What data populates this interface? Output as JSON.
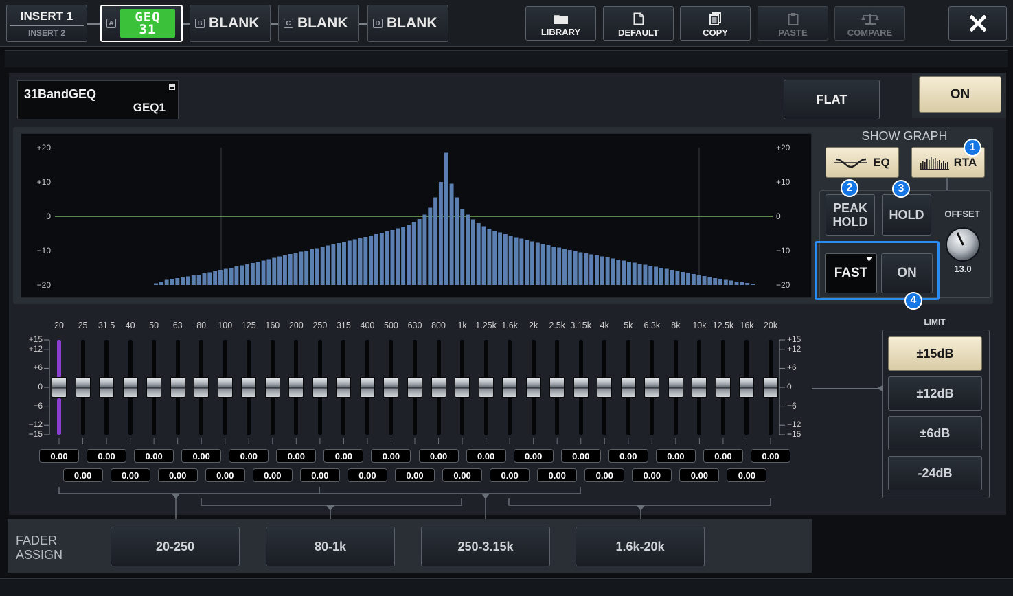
{
  "topbar": {
    "insert_label": "INSERT 1",
    "insert_sub": "INSERT 2",
    "slots": [
      {
        "letter": "A",
        "label": "GEQ31",
        "line1": "GEQ",
        "line2": "31",
        "active": true
      },
      {
        "letter": "B",
        "label": "BLANK",
        "active": false
      },
      {
        "letter": "C",
        "label": "BLANK",
        "active": false
      },
      {
        "letter": "D",
        "label": "BLANK",
        "active": false
      }
    ],
    "buttons": [
      {
        "label": "LIBRARY",
        "icon": "folder-icon",
        "enabled": true
      },
      {
        "label": "DEFAULT",
        "icon": "document-icon",
        "enabled": true
      },
      {
        "label": "COPY",
        "icon": "copy-icon",
        "enabled": true
      },
      {
        "label": "PASTE",
        "icon": "clipboard-icon",
        "enabled": false
      },
      {
        "label": "COMPARE",
        "icon": "balance-icon",
        "enabled": false
      }
    ],
    "close_icon": "close-icon"
  },
  "header": {
    "effect_type": "31BandGEQ",
    "effect_name": "GEQ1",
    "flat_label": "FLAT",
    "on_label": "ON"
  },
  "graph": {
    "y_ticks": [
      "+20",
      "+10",
      "0",
      "−10",
      "−20"
    ],
    "accent_color": "#5a7fb0",
    "zero_line_color": "#8ccf6a"
  },
  "chart_data": {
    "type": "bar",
    "ylim": [
      -20,
      20
    ],
    "x_index": [
      0,
      1,
      2,
      3,
      4,
      5,
      6,
      7,
      8,
      9,
      10,
      11,
      12,
      13,
      14,
      15,
      16,
      17,
      18,
      19,
      20,
      21,
      22,
      23,
      24,
      25,
      26,
      27,
      28,
      29,
      30,
      31,
      32,
      33,
      34,
      35,
      36,
      37,
      38,
      39,
      40,
      41,
      42,
      43,
      44,
      45,
      46,
      47,
      48,
      49,
      50,
      51,
      52,
      53,
      54,
      55,
      56,
      57,
      58,
      59,
      60,
      61,
      62,
      63,
      64,
      65,
      66,
      67,
      68,
      69,
      70,
      71,
      72,
      73,
      74,
      75,
      76,
      77,
      78,
      79,
      80,
      81,
      82,
      83,
      84,
      85,
      86,
      87,
      88,
      89,
      90,
      91,
      92,
      93,
      94,
      95,
      96,
      97,
      98,
      99,
      100,
      101,
      102,
      103,
      104,
      105,
      106,
      107,
      108,
      109,
      110,
      111,
      112,
      113,
      114,
      115,
      116,
      117,
      118,
      119,
      120
    ],
    "values": [
      -19.5,
      -19,
      -18.5,
      -18.2,
      -18,
      -17.8,
      -17.5,
      -17.2,
      -17,
      -16.6,
      -16.3,
      -16,
      -15.6,
      -15.3,
      -15,
      -14.6,
      -14.3,
      -14,
      -13.6,
      -13.2,
      -12.9,
      -12.5,
      -12.1,
      -11.7,
      -11.4,
      -11,
      -10.7,
      -10.3,
      -10,
      -9.6,
      -9.3,
      -8.9,
      -8.5,
      -8.2,
      -7.8,
      -7.5,
      -7.1,
      -6.7,
      -6.4,
      -6,
      -5.6,
      -5.2,
      -4.8,
      -4.4,
      -4,
      -3.5,
      -3,
      -2.4,
      -1.7,
      -0.8,
      0.5,
      2.5,
      5.5,
      10,
      18.5,
      9.5,
      5.5,
      2.2,
      0.5,
      -0.9,
      -2,
      -2.9,
      -3.6,
      -4.2,
      -4.7,
      -5.2,
      -5.7,
      -6.1,
      -6.5,
      -6.9,
      -7.3,
      -7.7,
      -8.1,
      -8.4,
      -8.8,
      -9.1,
      -9.5,
      -9.8,
      -10.1,
      -10.5,
      -10.8,
      -11.1,
      -11.4,
      -11.7,
      -12,
      -12.3,
      -12.6,
      -12.9,
      -13.2,
      -13.5,
      -13.8,
      -14.1,
      -14.4,
      -14.7,
      -15,
      -15.3,
      -15.6,
      -15.9,
      -16.2,
      -16.5,
      -16.8,
      -17.1,
      -17.4,
      -17.7,
      -18,
      -18.2,
      -18.5,
      -18.7,
      -19,
      -19.2,
      -19.4,
      -19.6
    ],
    "title": "",
    "xlabel": "",
    "ylabel": ""
  },
  "show_graph": {
    "title": "SHOW GRAPH",
    "eq_label": "EQ",
    "rta_label": "RTA",
    "eq_icon": "eq-curve-icon",
    "rta_icon": "rta-bars-icon"
  },
  "rta": {
    "peak_hold_line1": "PEAK",
    "peak_hold_line2": "HOLD",
    "hold_label": "HOLD",
    "offset_label": "OFFSET",
    "offset_value": "13.0",
    "speed_value": "FAST",
    "speed_on_label": "ON"
  },
  "badges": [
    "1",
    "2",
    "3",
    "4"
  ],
  "faders": {
    "freqs": [
      "20",
      "25",
      "31.5",
      "40",
      "50",
      "63",
      "80",
      "100",
      "125",
      "160",
      "200",
      "250",
      "315",
      "400",
      "500",
      "630",
      "800",
      "1k",
      "1.25k",
      "1.6k",
      "2k",
      "2.5k",
      "3.15k",
      "4k",
      "5k",
      "6.3k",
      "8k",
      "10k",
      "12.5k",
      "16k",
      "20k"
    ],
    "scale_left": [
      "+15",
      "+12",
      "+6",
      "0",
      "−6",
      "−12",
      "−15"
    ],
    "scale_right": [
      "+15",
      "+12",
      "+6",
      "0",
      "−6",
      "−12",
      "−15"
    ],
    "values": [
      "0.00",
      "0.00",
      "0.00",
      "0.00",
      "0.00",
      "0.00",
      "0.00",
      "0.00",
      "0.00",
      "0.00",
      "0.00",
      "0.00",
      "0.00",
      "0.00",
      "0.00",
      "0.00",
      "0.00",
      "0.00",
      "0.00",
      "0.00",
      "0.00",
      "0.00",
      "0.00",
      "0.00",
      "0.00",
      "0.00",
      "0.00",
      "0.00",
      "0.00",
      "0.00",
      "0.00"
    ],
    "levels_db": [
      0,
      0,
      0,
      0,
      0,
      0,
      0,
      0,
      0,
      0,
      0,
      0,
      0,
      0,
      0,
      0,
      0,
      0,
      0,
      0,
      0,
      0,
      0,
      0,
      0,
      0,
      0,
      0,
      0,
      0,
      0
    ],
    "marker_color": "#8a3fd0"
  },
  "limit": {
    "title": "LIMIT",
    "options": [
      "±15dB",
      "±12dB",
      "±6dB",
      "-24dB"
    ],
    "selected": 0
  },
  "fader_assign": {
    "label_line1": "FADER",
    "label_line2": "ASSIGN",
    "ranges": [
      "20-250",
      "80-1k",
      "250-3.15k",
      "1.6k-20k"
    ]
  }
}
